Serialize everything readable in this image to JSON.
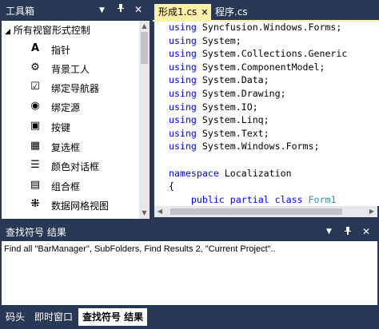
{
  "toolbox": {
    "title": "工具箱",
    "controls": [
      "▼",
      "ᵖ",
      "✕"
    ],
    "group_header": "所有视窗形式控制",
    "items": [
      {
        "label": "指针",
        "icon": "pointer-icon",
        "glyph": "A"
      },
      {
        "label": "背景工人",
        "icon": "background-worker-icon",
        "glyph": "⚙"
      },
      {
        "label": "绑定导航器",
        "icon": "binding-navigator-icon",
        "glyph": "☑"
      },
      {
        "label": "绑定源",
        "icon": "binding-source-icon",
        "glyph": "◉"
      },
      {
        "label": "按键",
        "icon": "button-icon",
        "glyph": "▣"
      },
      {
        "label": "复选框",
        "icon": "checkbox-icon",
        "glyph": "▦"
      },
      {
        "label": "颜色对话框",
        "icon": "list-icon",
        "glyph": "☰"
      },
      {
        "label": "组合框",
        "icon": "combobox-icon",
        "glyph": "▤"
      },
      {
        "label": "数据网格视图",
        "icon": "datagrid-icon",
        "glyph": "⁜"
      }
    ]
  },
  "editor": {
    "tabs": [
      {
        "label": "形成1.cs",
        "close": "✕"
      },
      {
        "label": "程序.cs"
      }
    ],
    "code_lines": [
      [
        {
          "t": "using",
          "c": "kw"
        },
        {
          "t": " Syncfusion.Windows.Forms;"
        }
      ],
      [
        {
          "t": "using",
          "c": "kw"
        },
        {
          "t": " System;"
        }
      ],
      [
        {
          "t": "using",
          "c": "kw"
        },
        {
          "t": " System.Collections.Generic"
        }
      ],
      [
        {
          "t": "using",
          "c": "kw"
        },
        {
          "t": " System.ComponentModel;"
        }
      ],
      [
        {
          "t": "using",
          "c": "kw"
        },
        {
          "t": " System.Data;"
        }
      ],
      [
        {
          "t": "using",
          "c": "kw"
        },
        {
          "t": " System.Drawing;"
        }
      ],
      [
        {
          "t": "using",
          "c": "kw"
        },
        {
          "t": " System.IO;"
        }
      ],
      [
        {
          "t": "using",
          "c": "kw"
        },
        {
          "t": " System.Linq;"
        }
      ],
      [
        {
          "t": "using",
          "c": "kw"
        },
        {
          "t": " System.Text;"
        }
      ],
      [
        {
          "t": "using",
          "c": "kw"
        },
        {
          "t": " System.Windows.Forms;"
        }
      ],
      [],
      [
        {
          "t": "namespace",
          "c": "kw"
        },
        {
          "t": " Localization"
        }
      ],
      [
        {
          "t": "{"
        }
      ],
      [
        {
          "t": "    "
        },
        {
          "t": "public",
          "c": "kw"
        },
        {
          "t": " "
        },
        {
          "t": "partial",
          "c": "kw"
        },
        {
          "t": " "
        },
        {
          "t": "class",
          "c": "kw"
        },
        {
          "t": " "
        },
        {
          "t": "Form1",
          "c": "cls"
        }
      ]
    ]
  },
  "find_results": {
    "title": "查找符号 结果",
    "controls": [
      "▼",
      "ᵖ",
      "✕"
    ],
    "text": "Find all \"BarManager\", SubFolders, Find Results 2, \"Current Project\".."
  },
  "bottom_tabs": [
    {
      "label": "码头",
      "active": false
    },
    {
      "label": "即时窗口",
      "active": false
    },
    {
      "label": "查找符号 结果",
      "active": true
    }
  ],
  "colors": {
    "chrome": "#293955",
    "active_tab": "#fff1a8",
    "keyword": "#0000ff",
    "type": "#2b91af"
  }
}
